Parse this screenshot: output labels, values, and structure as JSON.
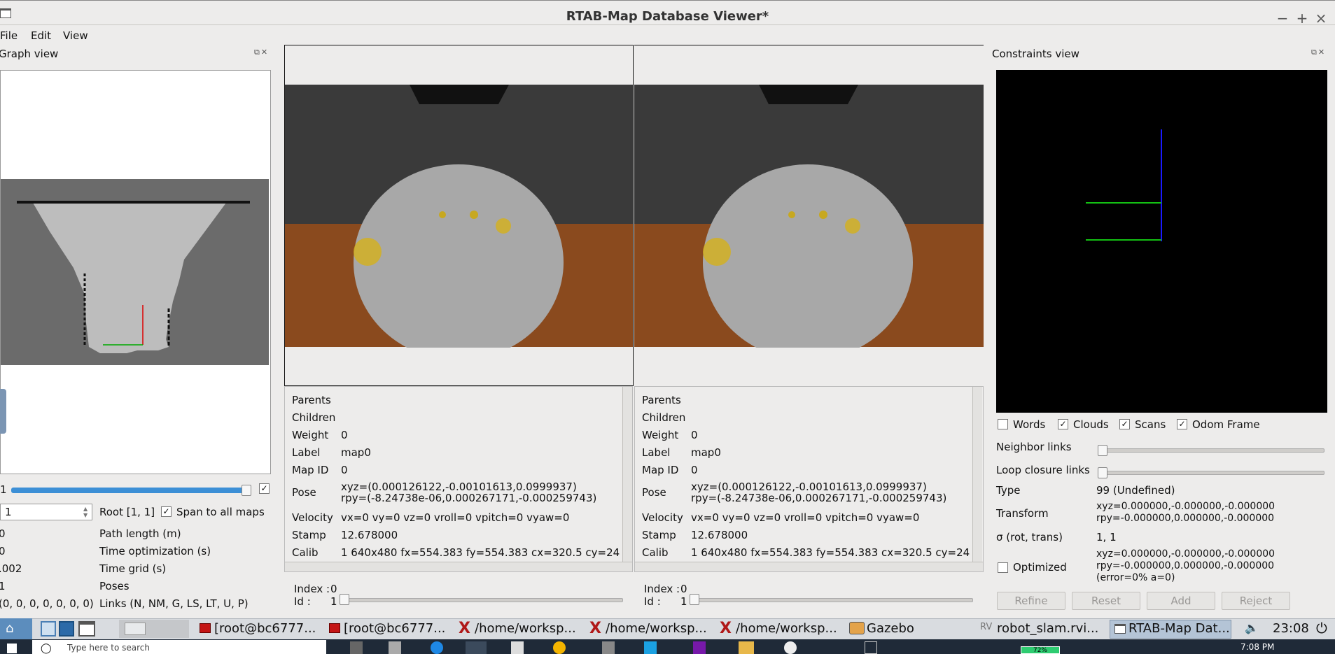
{
  "window": {
    "title": "RTAB-Map Database Viewer*",
    "minimize": "−",
    "maximize": "+",
    "close": "×"
  },
  "menu": [
    "File",
    "Edit",
    "View"
  ],
  "graph_view": {
    "title": "Graph view",
    "slider_value": "1",
    "spin_value": "1",
    "root_label": "Root [1, 1]",
    "span_label": "Span to all maps",
    "stats": [
      {
        "value": "0",
        "label": "Path length (m)"
      },
      {
        "value": "0",
        "label": "Time optimization (s)"
      },
      {
        "value": ".002",
        "label": "Time grid (s)"
      },
      {
        "value": "1",
        "label": "Poses"
      },
      {
        "value": "(0, 0, 0, 0, 0, 0, 0)",
        "label": "Links (N, NM, G, LS, LT, U, P)"
      }
    ]
  },
  "node_left": {
    "rows": [
      {
        "k": "Parents",
        "v": ""
      },
      {
        "k": "Children",
        "v": ""
      },
      {
        "k": "Weight",
        "v": "0"
      },
      {
        "k": "Label",
        "v": "map0"
      },
      {
        "k": "Map ID",
        "v": "0"
      },
      {
        "k": "Pose",
        "v": "xyz=(0.000126122,-0.00101613,0.0999937)",
        "v2": "rpy=(-8.24738e-06,0.000267171,-0.000259743)"
      },
      {
        "k": "Velocity",
        "v": "vx=0 vy=0 vz=0 vroll=0 vpitch=0 vyaw=0"
      },
      {
        "k": "Stamp",
        "v": "12.678000"
      },
      {
        "k": "Calib",
        "v": "1 640x480 fx=554.383 fy=554.383 cx=320.5 cy=24"
      }
    ],
    "index_label": "Index :",
    "index_value": "0",
    "id_label": "Id :",
    "id_value": "1"
  },
  "node_right": {
    "rows": [
      {
        "k": "Parents",
        "v": ""
      },
      {
        "k": "Children",
        "v": ""
      },
      {
        "k": "Weight",
        "v": "0"
      },
      {
        "k": "Label",
        "v": "map0"
      },
      {
        "k": "Map ID",
        "v": "0"
      },
      {
        "k": "Pose",
        "v": "xyz=(0.000126122,-0.00101613,0.0999937)",
        "v2": "rpy=(-8.24738e-06,0.000267171,-0.000259743)"
      },
      {
        "k": "Velocity",
        "v": "vx=0 vy=0 vz=0 vroll=0 vpitch=0 vyaw=0"
      },
      {
        "k": "Stamp",
        "v": "12.678000"
      },
      {
        "k": "Calib",
        "v": "1 640x480 fx=554.383 fy=554.383 cx=320.5 cy=24"
      }
    ],
    "index_label": "Index :",
    "index_value": "0",
    "id_label": "Id :",
    "id_value": "1"
  },
  "constraints": {
    "title": "Constraints view",
    "checks": [
      {
        "label": "Words",
        "checked": false
      },
      {
        "label": "Clouds",
        "checked": true
      },
      {
        "label": "Scans",
        "checked": true
      },
      {
        "label": "Odom Frame",
        "checked": true
      }
    ],
    "neighbor_links": "Neighbor links",
    "loop_links": "Loop closure links",
    "type_label": "Type",
    "type_value": "99 (Undefined)",
    "transform_label": "Transform",
    "transform_xyz": "xyz=0.000000,-0.000000,-0.000000",
    "transform_rpy": "rpy=-0.000000,0.000000,-0.000000",
    "sigma_label": "σ (rot, trans)",
    "sigma_value": "1, 1",
    "optimized_label": "Optimized",
    "opt_xyz": "xyz=0.000000,-0.000000,-0.000000",
    "opt_rpy": "rpy=-0.000000,0.000000,-0.000000",
    "opt_err": "(error=0% a=0)",
    "buttons": [
      "Refine",
      "Reset",
      "Add",
      "Reject"
    ]
  },
  "taskbar": {
    "tasks": [
      "[root@bc6777...",
      "[root@bc6777...",
      "/home/worksp...",
      "/home/worksp...",
      "/home/worksp...",
      "Gazebo",
      "robot_slam.rvi...",
      "RTAB-Map Dat..."
    ],
    "clock": "23:08"
  },
  "winbar": {
    "search": "Type here to search",
    "battery": "72%",
    "time": "7:08 PM"
  },
  "colors": {
    "accent": "#3c8fd6",
    "graph_gray": "#6b6b6b",
    "free_space": "#bdbdbd"
  }
}
